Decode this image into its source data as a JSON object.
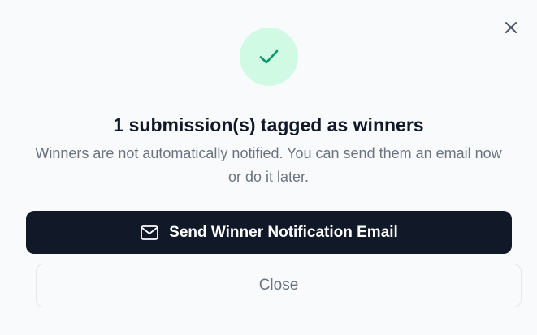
{
  "dialog": {
    "title": "1 submission(s) tagged as winners",
    "message": "Winners are not automatically notified. You can send them an email now or do it later.",
    "close_icon": "close-icon",
    "status_icon": "check-icon",
    "primary_button": {
      "label": "Send Winner Notification Email",
      "icon": "mail-icon"
    },
    "secondary_button": {
      "label": "Close"
    }
  },
  "colors": {
    "background": "#f9fafb",
    "success_bg": "#d1fae5",
    "success_check": "#059669",
    "primary_button_bg": "#111827",
    "title_text": "#111827",
    "muted_text": "#6b7280"
  }
}
